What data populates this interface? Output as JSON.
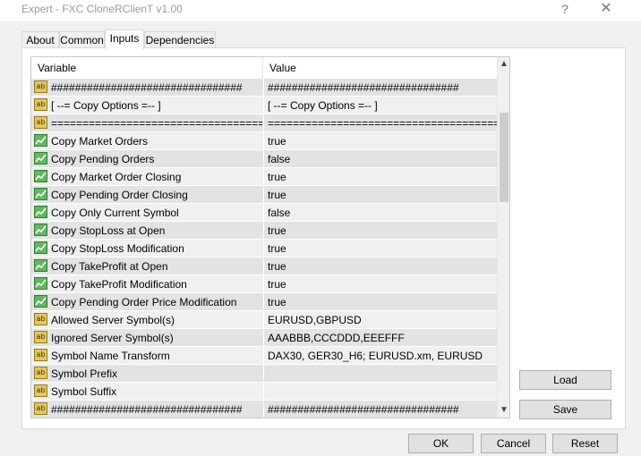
{
  "window": {
    "title": "Expert - FXC CloneRClienT v1.00",
    "help_label": "?",
    "close_label": "✕"
  },
  "tabs": [
    {
      "label": "About",
      "active": false
    },
    {
      "label": "Common",
      "active": false
    },
    {
      "label": "Inputs",
      "active": true
    },
    {
      "label": "Dependencies",
      "active": false
    }
  ],
  "grid": {
    "columns": {
      "variable": "Variable",
      "value": "Value"
    },
    "rows": [
      {
        "icon": "ab-icon",
        "variable": "################################",
        "value": "################################"
      },
      {
        "icon": "ab-icon",
        "variable": "[ --= Copy Options =-- ]",
        "value": "[ --= Copy Options =-- ]"
      },
      {
        "icon": "ab-icon",
        "variable": "======================================",
        "value": "======================================"
      },
      {
        "icon": "bool-icon",
        "variable": "Copy Market Orders",
        "value": "true"
      },
      {
        "icon": "bool-icon",
        "variable": "Copy Pending Orders",
        "value": "false"
      },
      {
        "icon": "bool-icon",
        "variable": "Copy Market Order Closing",
        "value": "true"
      },
      {
        "icon": "bool-icon",
        "variable": "Copy Pending Order Closing",
        "value": "true"
      },
      {
        "icon": "bool-icon",
        "variable": "Copy Only Current Symbol",
        "value": "false"
      },
      {
        "icon": "bool-icon",
        "variable": "Copy StopLoss at Open",
        "value": "true"
      },
      {
        "icon": "bool-icon",
        "variable": "Copy StopLoss Modification",
        "value": "true"
      },
      {
        "icon": "bool-icon",
        "variable": "Copy TakeProfit at Open",
        "value": "true"
      },
      {
        "icon": "bool-icon",
        "variable": "Copy TakeProfit Modification",
        "value": "true"
      },
      {
        "icon": "bool-icon",
        "variable": "Copy Pending Order Price Modification",
        "value": "true"
      },
      {
        "icon": "ab-icon",
        "variable": "Allowed Server Symbol(s)",
        "value": "EURUSD,GBPUSD"
      },
      {
        "icon": "ab-icon",
        "variable": "Ignored Server Symbol(s)",
        "value": "AAABBB,CCCDDD,EEEFFF"
      },
      {
        "icon": "ab-icon",
        "variable": "Symbol Name Transform",
        "value": "DAX30, GER30_H6; EURUSD.xm, EURUSD"
      },
      {
        "icon": "ab-icon",
        "variable": "Symbol Prefix",
        "value": ""
      },
      {
        "icon": "ab-icon",
        "variable": "Symbol Suffix",
        "value": ""
      },
      {
        "icon": "ab-icon",
        "variable": "################################",
        "value": "################################"
      }
    ]
  },
  "side_buttons": {
    "load": "Load",
    "save": "Save"
  },
  "footer_buttons": {
    "ok": "OK",
    "cancel": "Cancel",
    "reset": "Reset"
  },
  "icons": {
    "ab": "ab",
    "scroll_up": "▲",
    "scroll_down": "▼"
  },
  "colors": {
    "row_dark": "#e3e3e3",
    "row_light": "#f0f0f0",
    "string_icon": "#e8c752",
    "bool_icon": "#5fb95f"
  }
}
